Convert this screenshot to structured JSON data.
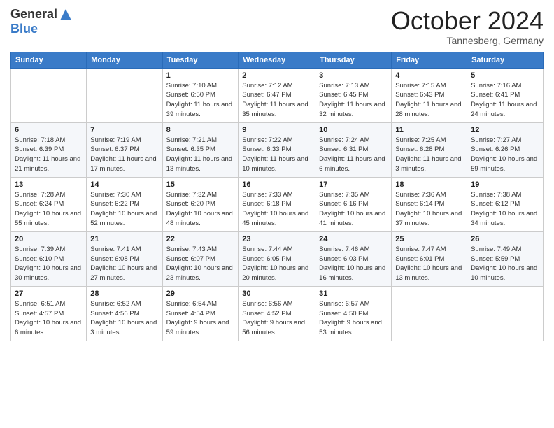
{
  "logo": {
    "general": "General",
    "blue": "Blue"
  },
  "header": {
    "month": "October 2024",
    "location": "Tannesberg, Germany"
  },
  "weekdays": [
    "Sunday",
    "Monday",
    "Tuesday",
    "Wednesday",
    "Thursday",
    "Friday",
    "Saturday"
  ],
  "weeks": [
    [
      {
        "day": "",
        "sunrise": "",
        "sunset": "",
        "daylight": ""
      },
      {
        "day": "",
        "sunrise": "",
        "sunset": "",
        "daylight": ""
      },
      {
        "day": "1",
        "sunrise": "Sunrise: 7:10 AM",
        "sunset": "Sunset: 6:50 PM",
        "daylight": "Daylight: 11 hours and 39 minutes."
      },
      {
        "day": "2",
        "sunrise": "Sunrise: 7:12 AM",
        "sunset": "Sunset: 6:47 PM",
        "daylight": "Daylight: 11 hours and 35 minutes."
      },
      {
        "day": "3",
        "sunrise": "Sunrise: 7:13 AM",
        "sunset": "Sunset: 6:45 PM",
        "daylight": "Daylight: 11 hours and 32 minutes."
      },
      {
        "day": "4",
        "sunrise": "Sunrise: 7:15 AM",
        "sunset": "Sunset: 6:43 PM",
        "daylight": "Daylight: 11 hours and 28 minutes."
      },
      {
        "day": "5",
        "sunrise": "Sunrise: 7:16 AM",
        "sunset": "Sunset: 6:41 PM",
        "daylight": "Daylight: 11 hours and 24 minutes."
      }
    ],
    [
      {
        "day": "6",
        "sunrise": "Sunrise: 7:18 AM",
        "sunset": "Sunset: 6:39 PM",
        "daylight": "Daylight: 11 hours and 21 minutes."
      },
      {
        "day": "7",
        "sunrise": "Sunrise: 7:19 AM",
        "sunset": "Sunset: 6:37 PM",
        "daylight": "Daylight: 11 hours and 17 minutes."
      },
      {
        "day": "8",
        "sunrise": "Sunrise: 7:21 AM",
        "sunset": "Sunset: 6:35 PM",
        "daylight": "Daylight: 11 hours and 13 minutes."
      },
      {
        "day": "9",
        "sunrise": "Sunrise: 7:22 AM",
        "sunset": "Sunset: 6:33 PM",
        "daylight": "Daylight: 11 hours and 10 minutes."
      },
      {
        "day": "10",
        "sunrise": "Sunrise: 7:24 AM",
        "sunset": "Sunset: 6:31 PM",
        "daylight": "Daylight: 11 hours and 6 minutes."
      },
      {
        "day": "11",
        "sunrise": "Sunrise: 7:25 AM",
        "sunset": "Sunset: 6:28 PM",
        "daylight": "Daylight: 11 hours and 3 minutes."
      },
      {
        "day": "12",
        "sunrise": "Sunrise: 7:27 AM",
        "sunset": "Sunset: 6:26 PM",
        "daylight": "Daylight: 10 hours and 59 minutes."
      }
    ],
    [
      {
        "day": "13",
        "sunrise": "Sunrise: 7:28 AM",
        "sunset": "Sunset: 6:24 PM",
        "daylight": "Daylight: 10 hours and 55 minutes."
      },
      {
        "day": "14",
        "sunrise": "Sunrise: 7:30 AM",
        "sunset": "Sunset: 6:22 PM",
        "daylight": "Daylight: 10 hours and 52 minutes."
      },
      {
        "day": "15",
        "sunrise": "Sunrise: 7:32 AM",
        "sunset": "Sunset: 6:20 PM",
        "daylight": "Daylight: 10 hours and 48 minutes."
      },
      {
        "day": "16",
        "sunrise": "Sunrise: 7:33 AM",
        "sunset": "Sunset: 6:18 PM",
        "daylight": "Daylight: 10 hours and 45 minutes."
      },
      {
        "day": "17",
        "sunrise": "Sunrise: 7:35 AM",
        "sunset": "Sunset: 6:16 PM",
        "daylight": "Daylight: 10 hours and 41 minutes."
      },
      {
        "day": "18",
        "sunrise": "Sunrise: 7:36 AM",
        "sunset": "Sunset: 6:14 PM",
        "daylight": "Daylight: 10 hours and 37 minutes."
      },
      {
        "day": "19",
        "sunrise": "Sunrise: 7:38 AM",
        "sunset": "Sunset: 6:12 PM",
        "daylight": "Daylight: 10 hours and 34 minutes."
      }
    ],
    [
      {
        "day": "20",
        "sunrise": "Sunrise: 7:39 AM",
        "sunset": "Sunset: 6:10 PM",
        "daylight": "Daylight: 10 hours and 30 minutes."
      },
      {
        "day": "21",
        "sunrise": "Sunrise: 7:41 AM",
        "sunset": "Sunset: 6:08 PM",
        "daylight": "Daylight: 10 hours and 27 minutes."
      },
      {
        "day": "22",
        "sunrise": "Sunrise: 7:43 AM",
        "sunset": "Sunset: 6:07 PM",
        "daylight": "Daylight: 10 hours and 23 minutes."
      },
      {
        "day": "23",
        "sunrise": "Sunrise: 7:44 AM",
        "sunset": "Sunset: 6:05 PM",
        "daylight": "Daylight: 10 hours and 20 minutes."
      },
      {
        "day": "24",
        "sunrise": "Sunrise: 7:46 AM",
        "sunset": "Sunset: 6:03 PM",
        "daylight": "Daylight: 10 hours and 16 minutes."
      },
      {
        "day": "25",
        "sunrise": "Sunrise: 7:47 AM",
        "sunset": "Sunset: 6:01 PM",
        "daylight": "Daylight: 10 hours and 13 minutes."
      },
      {
        "day": "26",
        "sunrise": "Sunrise: 7:49 AM",
        "sunset": "Sunset: 5:59 PM",
        "daylight": "Daylight: 10 hours and 10 minutes."
      }
    ],
    [
      {
        "day": "27",
        "sunrise": "Sunrise: 6:51 AM",
        "sunset": "Sunset: 4:57 PM",
        "daylight": "Daylight: 10 hours and 6 minutes."
      },
      {
        "day": "28",
        "sunrise": "Sunrise: 6:52 AM",
        "sunset": "Sunset: 4:56 PM",
        "daylight": "Daylight: 10 hours and 3 minutes."
      },
      {
        "day": "29",
        "sunrise": "Sunrise: 6:54 AM",
        "sunset": "Sunset: 4:54 PM",
        "daylight": "Daylight: 9 hours and 59 minutes."
      },
      {
        "day": "30",
        "sunrise": "Sunrise: 6:56 AM",
        "sunset": "Sunset: 4:52 PM",
        "daylight": "Daylight: 9 hours and 56 minutes."
      },
      {
        "day": "31",
        "sunrise": "Sunrise: 6:57 AM",
        "sunset": "Sunset: 4:50 PM",
        "daylight": "Daylight: 9 hours and 53 minutes."
      },
      {
        "day": "",
        "sunrise": "",
        "sunset": "",
        "daylight": ""
      },
      {
        "day": "",
        "sunrise": "",
        "sunset": "",
        "daylight": ""
      }
    ]
  ]
}
